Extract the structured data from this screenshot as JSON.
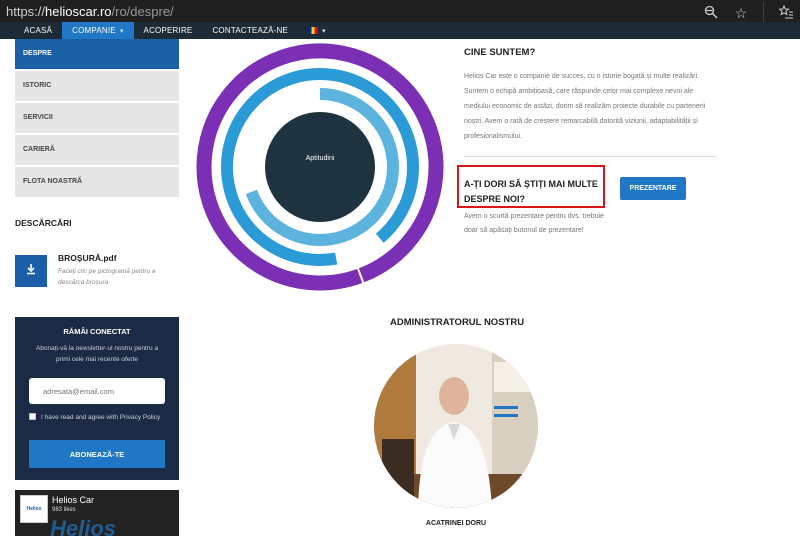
{
  "browser": {
    "url_scheme": "https://",
    "url_domain": "helioscar.ro",
    "url_path": "/ro/despre/"
  },
  "nav": {
    "items": [
      {
        "label": "ACASĂ"
      },
      {
        "label": "COMPANIE",
        "active": true
      },
      {
        "label": "ACOPERIRE"
      },
      {
        "label": "CONTACTEAZĂ-NE"
      }
    ]
  },
  "sidebar": {
    "items": [
      {
        "label": "DESPRE",
        "active": true
      },
      {
        "label": "ISTORIC"
      },
      {
        "label": "SERVICII"
      },
      {
        "label": "CARIERĂ"
      },
      {
        "label": "FLOTA NOASTRĂ"
      }
    ]
  },
  "downloads": {
    "heading": "DESCĂRCĂRI",
    "file_title": "BROȘURĂ.pdf",
    "file_desc": "Faceți clic pe pictogramă pentru a descărca broșura"
  },
  "newsletter": {
    "title": "RĂMÂI CONECTAT",
    "desc": "Abonați-vă la newsletter-ul nostru pentru a primi cele mai recente oferte",
    "placeholder": "adresata@email.com",
    "terms": "I have read and agree with Privacy Policy",
    "button": "ABONEAZĂ-TE"
  },
  "facebook": {
    "name": "Helios Car",
    "likes": "983 likes",
    "logo_text": "Helios",
    "watermark": "Helios"
  },
  "rings": {
    "center_label": "Aptitudini",
    "colors": {
      "outer": "#7b2fb5",
      "middle": "#2a9bd6",
      "inner": "#5cb3dd",
      "center": "#1d3340"
    }
  },
  "about": {
    "heading": "CINE SUNTEM?",
    "text": "Helios Car este o companie de succes, cu o istorie bogată și multe realizări. Suntem o echipă ambițioasă, care răspunde celor mai complexe nevoi ale mediului economic de astăzi, dorim să realizăm proiecte durabile cu partenerii noștri. Avem o rată de creștere remarcabilă datorită viziunii, adaptabilității și profesionalismului."
  },
  "cta": {
    "heading": "A-ȚI DORI SĂ ȘTIȚI MAI MULTE DESPRE NOI?",
    "text": "Avem o scurtă prezentare pentru dvs. trebuie doar să apăsați butonul de prezentare!",
    "button": "PREZENTARE"
  },
  "admin": {
    "heading": "ADMINISTRATORUL NOSTRU",
    "name": "ACATRINEI DORU"
  },
  "colors": {
    "nav_bg": "#1c2b36",
    "accent": "#1f77c5",
    "highlight_border": "#d9151c"
  }
}
